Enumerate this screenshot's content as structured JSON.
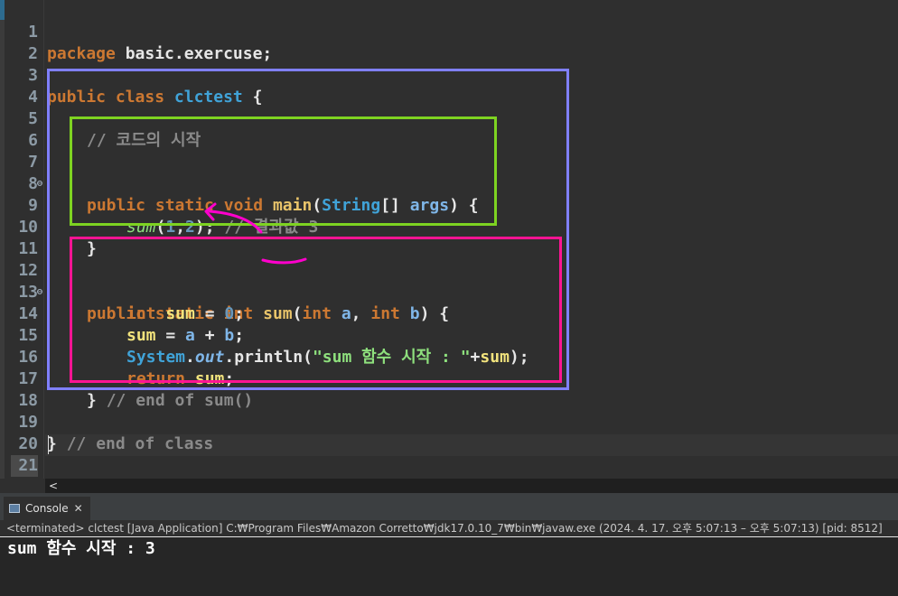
{
  "editor": {
    "line_numbers": [
      "1",
      "2",
      "3",
      "4",
      "5",
      "6",
      "7",
      "8",
      "9",
      "10",
      "11",
      "12",
      "13",
      "14",
      "15",
      "16",
      "17",
      "18",
      "19",
      "20",
      "21"
    ],
    "fold_marker": "⊖",
    "line1": {
      "kw": "package",
      "rest": "basic.exercuse;"
    },
    "line3": {
      "kw1": "public",
      "kw2": "class",
      "cls": "clctest",
      "rest": "{"
    },
    "line5": {
      "comment": "// 코드의 시작"
    },
    "line7": {
      "kw1": "public",
      "kw2": "static",
      "kw3": "void",
      "fn": "main",
      "p1": "(",
      "type": "String",
      "p2": "[] ",
      "param": "args",
      "p3": ") {"
    },
    "line9": {
      "call": "sum",
      "p1": "(",
      "n1": "1",
      "comma": ",",
      "n2": "2",
      "p2": ");",
      "comment": "// 결과값 3"
    },
    "line10": {
      "text": "}"
    },
    "line12": {
      "kw1": "public",
      "kw2": "static",
      "kw3": "int",
      "fn": "sum",
      "p1": "(",
      "kw4": "int",
      "pa": "a",
      "comma": ",",
      "kw5": "int",
      "pb": "b",
      "p2": ") {"
    },
    "line13": {
      "kw": "int",
      "var": "sum",
      "eq": "=",
      "num": "0",
      "semi": ";"
    },
    "line14": {
      "var": "sum",
      "eq": "=",
      "pa": "a",
      "plus": "+",
      "pb": "b",
      "semi": ";"
    },
    "line15": {
      "sys": "System",
      "dot1": ".",
      "out": "out",
      "dot2": ".",
      "println": "println",
      "p1": "(",
      "str": "\"sum 함수 시작 : \"",
      "plus": "+",
      "var": "sum",
      "p2": ");"
    },
    "line16": {
      "kw": "return",
      "var": "sum",
      "semi": ";"
    },
    "line17": {
      "brace": "}",
      "comment": "// end of sum()"
    },
    "line19": {
      "brace": "}",
      "comment": "// end of class"
    }
  },
  "scrollbar": {
    "left_arrow": "<"
  },
  "console": {
    "tab_label": "Console",
    "close_glyph": "✕",
    "status": "<terminated> clctest [Java Application] C:₩Program Files₩Amazon Corretto₩jdk17.0.10_7₩bin₩javaw.exe  (2024. 4. 17. 오후 5:07:13 – 오후 5:07:13) [pid: 8512]",
    "output": "sum 함수 시작 : 3"
  },
  "colors": {
    "box_outer": "#8080ff",
    "box_main": "#7ed321",
    "box_sum": "#ff1493",
    "annotation_pen": "#ff00cc"
  },
  "icons": [
    "console-icon",
    "close-icon",
    "fold-marker-icon",
    "scroll-left-icon"
  ]
}
